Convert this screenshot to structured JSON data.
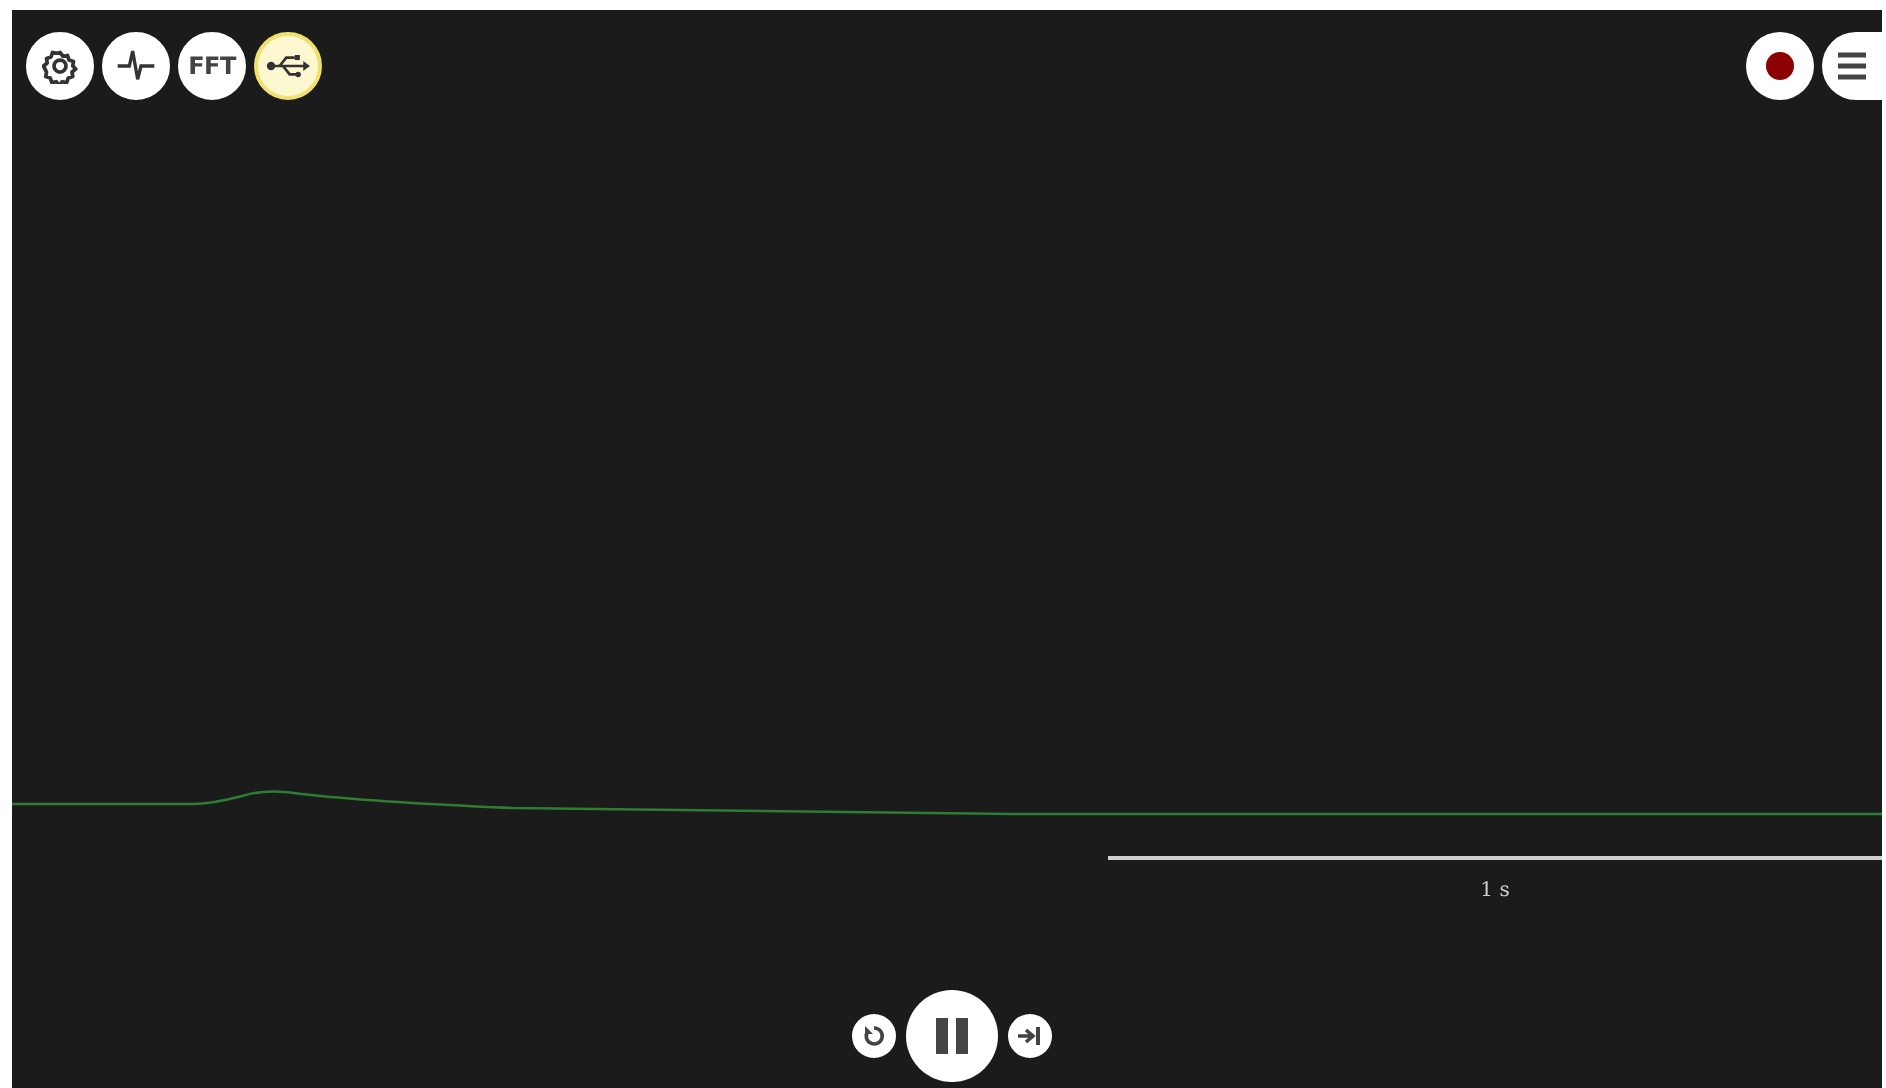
{
  "toolbar_left": [
    {
      "kind": "settings",
      "selected": false
    },
    {
      "kind": "signal",
      "selected": false
    },
    {
      "kind": "text",
      "label": "FFT",
      "selected": false
    },
    {
      "kind": "usb",
      "selected": true
    }
  ],
  "toolbar_right": [
    {
      "kind": "record"
    },
    {
      "kind": "menu"
    }
  ],
  "scale_bar": {
    "label": "1 s"
  },
  "playback": [
    {
      "kind": "reset"
    },
    {
      "kind": "pause"
    },
    {
      "kind": "skip"
    }
  ]
}
